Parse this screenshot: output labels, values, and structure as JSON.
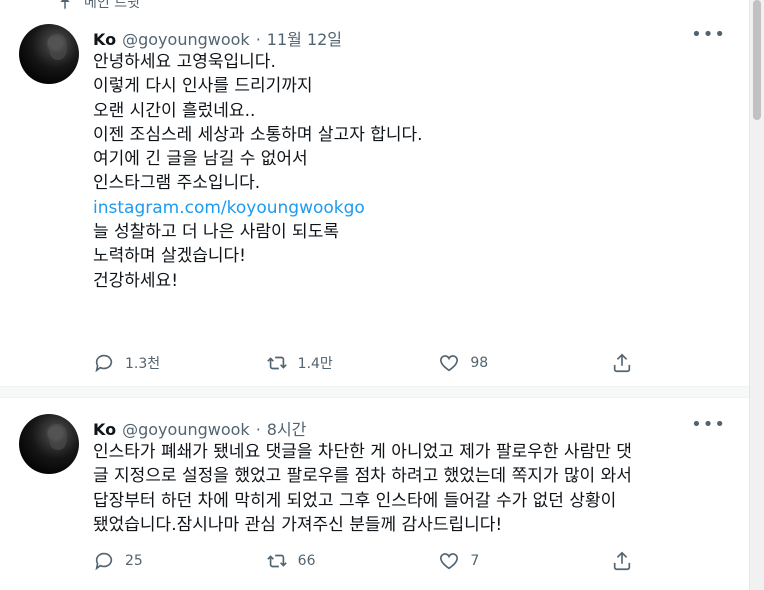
{
  "pinned": {
    "label": "메인 트윗"
  },
  "tweets": [
    {
      "author": {
        "name": "Ko",
        "handle": "@goyoungwook"
      },
      "separator": "·",
      "time": "11월 12일",
      "more_label": "•••",
      "lines": [
        "안녕하세요 고영욱입니다.",
        "이렇게 다시 인사를 드리기까지",
        "오랜 시간이 흘렀네요..",
        "이젠 조심스레 세상과 소통하며 살고자 합니다.",
        "여기에 긴 글을 남길 수 없어서",
        "인스타그램 주소입니다."
      ],
      "link": "instagram.com/koyoungwookgo",
      "lines_after": [
        "늘 성찰하고 더 나은 사람이 되도록",
        "노력하며 살겠습니다!",
        "건강하세요!"
      ],
      "stats": {
        "replies": "1.3천",
        "retweets": "1.4만",
        "likes": "98"
      }
    },
    {
      "author": {
        "name": "Ko",
        "handle": "@goyoungwook"
      },
      "separator": "·",
      "time": "8시간",
      "more_label": "•••",
      "lines": [
        "인스타가 폐쇄가 됐네요 댓글을 차단한 게 아니었고 제가 팔로우한 사람만 댓",
        "글 지정으로 설정을 했었고 팔로우를 점차 하려고 했었는데 쪽지가 많이 와서",
        "답장부터 하던 차에 막히게 되었고 그후 인스타에 들어갈 수가 없던 상황이",
        "됐었습니다.잠시나마 관심 가져주신 분들께 감사드립니다!"
      ],
      "stats": {
        "replies": "25",
        "retweets": "66",
        "likes": "7"
      }
    }
  ],
  "icons": {
    "pin": "pin-icon",
    "reply": "reply-icon",
    "retweet": "retweet-icon",
    "like": "heart-icon",
    "share": "share-icon",
    "more": "more-icon"
  },
  "colors": {
    "link": "#1d9bf0",
    "secondary_text": "#536471",
    "primary_text": "#0f1419"
  }
}
